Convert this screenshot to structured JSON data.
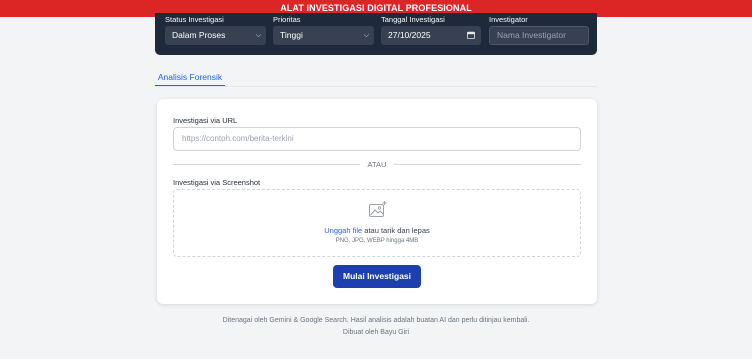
{
  "banner": {
    "title": "ALAT INVESTIGASI DIGITAL PROFESIONAL"
  },
  "filters": {
    "status": {
      "label": "Status Investigasi",
      "value": "Dalam Proses"
    },
    "priority": {
      "label": "Prioritas",
      "value": "Tinggi"
    },
    "date": {
      "label": "Tanggal Investigasi",
      "value": "27/10/2025"
    },
    "investigator": {
      "label": "Investigator",
      "placeholder": "Nama Investigator"
    }
  },
  "tabs": [
    {
      "label": "Analisis Forensik",
      "active": true
    }
  ],
  "form": {
    "url_label": "Investigasi via URL",
    "url_placeholder": "https://contoh.com/berita-terkini",
    "or_text": "ATAU",
    "screenshot_label": "Investigasi via Screenshot",
    "upload_link": "Unggah file",
    "upload_text": " atau tarik dan lepas",
    "upload_hint": "PNG, JPG, WEBP hingga 4MB",
    "submit_label": "Mulai Investigasi"
  },
  "footer": {
    "powered": "Ditenagai oleh Gemini & Google Search. Hasil analisis adalah buatan AI dan perlu ditinjau kembali.",
    "credit": "Dibuat oleh Bayu Giri"
  },
  "colors": {
    "banner": "#dc2626",
    "panel": "#1e293b",
    "accent": "#2563eb",
    "button": "#1e40af"
  }
}
